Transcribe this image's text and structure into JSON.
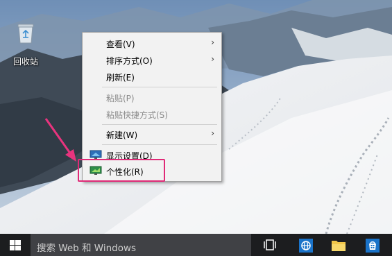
{
  "desktop": {
    "recycle_bin": {
      "label": "回收站",
      "icon": "recycle-bin-icon"
    }
  },
  "context_menu": {
    "items": [
      {
        "label": "查看(V)",
        "enabled": true,
        "submenu": true
      },
      {
        "label": "排序方式(O)",
        "enabled": true,
        "submenu": true
      },
      {
        "label": "刷新(E)",
        "enabled": true,
        "submenu": false
      },
      {
        "label": "粘贴(P)",
        "enabled": false,
        "submenu": false
      },
      {
        "label": "粘贴快捷方式(S)",
        "enabled": false,
        "submenu": false
      },
      {
        "label": "新建(W)",
        "enabled": true,
        "submenu": true
      },
      {
        "label": "显示设置(D)",
        "enabled": true,
        "submenu": false,
        "icon": "display-settings-icon"
      },
      {
        "label": "个性化(R)",
        "enabled": true,
        "submenu": false,
        "icon": "personalize-icon"
      }
    ],
    "submenu_arrow": "›",
    "highlight_color": "#e02a77"
  },
  "taskbar": {
    "start_icon": "windows-logo-icon",
    "search_placeholder": "搜索 Web 和 Windows",
    "icons": [
      "task-view-icon",
      "edge-browser-icon",
      "file-explorer-icon",
      "store-icon"
    ]
  },
  "colors": {
    "taskbar": "#1c1d1f",
    "search_box": "#404145",
    "menu_bg": "#f2f2f2"
  }
}
